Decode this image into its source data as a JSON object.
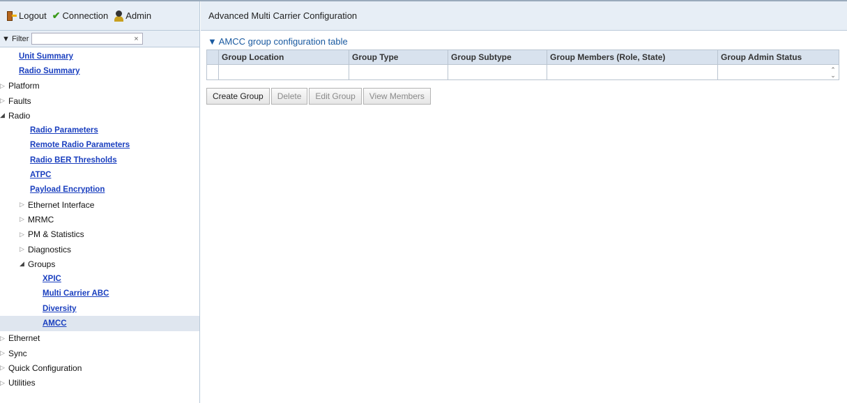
{
  "topbar": {
    "logout": "Logout",
    "connection": "Connection",
    "admin": "Admin"
  },
  "filter": {
    "label": "Filter",
    "value": "",
    "clear": "×"
  },
  "tree": [
    {
      "label": "Unit Summary",
      "link": true,
      "level": 0
    },
    {
      "label": "Radio Summary",
      "link": true,
      "level": 0
    },
    {
      "label": "Platform",
      "link": false,
      "level": 0,
      "arrow": "closed"
    },
    {
      "label": "Faults",
      "link": false,
      "level": 0,
      "arrow": "closed"
    },
    {
      "label": "Radio",
      "link": false,
      "level": 0,
      "arrow": "open"
    },
    {
      "label": "Radio Parameters",
      "link": true,
      "level": 1
    },
    {
      "label": "Remote Radio Parameters",
      "link": true,
      "level": 1
    },
    {
      "label": "Radio BER Thresholds",
      "link": true,
      "level": 1
    },
    {
      "label": "ATPC",
      "link": true,
      "level": 1
    },
    {
      "label": "Payload Encryption",
      "link": true,
      "level": 1
    },
    {
      "label": "Ethernet Interface",
      "link": false,
      "level": 1,
      "arrow": "closed"
    },
    {
      "label": "MRMC",
      "link": false,
      "level": 1,
      "arrow": "closed"
    },
    {
      "label": "PM & Statistics",
      "link": false,
      "level": 1,
      "arrow": "closed"
    },
    {
      "label": "Diagnostics",
      "link": false,
      "level": 1,
      "arrow": "closed"
    },
    {
      "label": "Groups",
      "link": false,
      "level": 1,
      "arrow": "open"
    },
    {
      "label": "XPIC",
      "link": true,
      "level": 2
    },
    {
      "label": "Multi Carrier ABC",
      "link": true,
      "level": 2
    },
    {
      "label": "Diversity",
      "link": true,
      "level": 2
    },
    {
      "label": "AMCC",
      "link": true,
      "level": 2,
      "selected": true
    },
    {
      "label": "Ethernet",
      "link": false,
      "level": 0,
      "arrow": "closed"
    },
    {
      "label": "Sync",
      "link": false,
      "level": 0,
      "arrow": "closed"
    },
    {
      "label": "Quick Configuration",
      "link": false,
      "level": 0,
      "arrow": "closed"
    },
    {
      "label": "Utilities",
      "link": false,
      "level": 0,
      "arrow": "closed"
    }
  ],
  "page": {
    "title": "Advanced Multi Carrier Configuration"
  },
  "section": {
    "title": "▼ AMCC group configuration table"
  },
  "table": {
    "columns": [
      "",
      "Group Location",
      "Group Type",
      "Group Subtype",
      "Group Members (Role, State)",
      "Group Admin Status"
    ]
  },
  "buttons": {
    "create": "Create Group",
    "delete": "Delete",
    "edit": "Edit Group",
    "view": "View Members"
  }
}
